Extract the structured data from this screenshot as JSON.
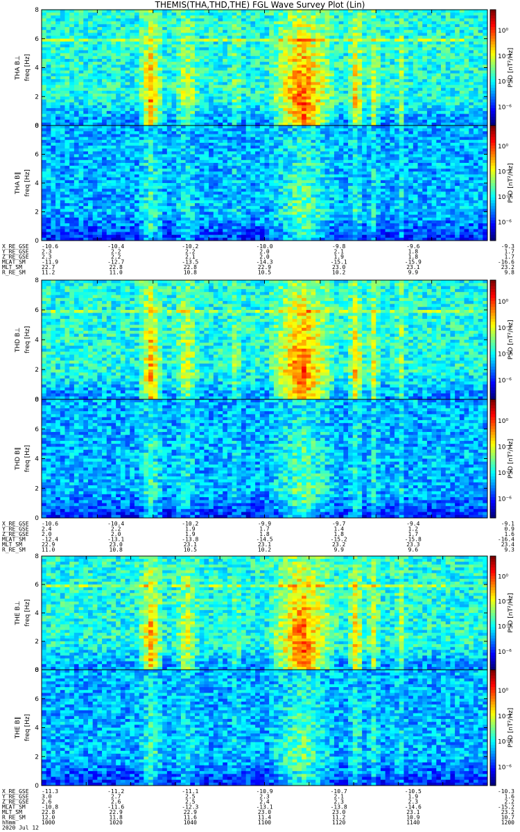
{
  "title": "THEMIS(THA,THD,THE) FGL Wave Survey Plot (Lin)",
  "chart_data": [
    {
      "type": "heatmap",
      "probe": "THA",
      "panels": [
        {
          "ylabel": "THA B⊥",
          "yunit": "freq [Hz]",
          "cbar_label": "PSD [nT²/Hz]"
        },
        {
          "ylabel": "THA B∥",
          "yunit": "freq [Hz]",
          "cbar_label": "PSD [nT²/Hz]"
        }
      ],
      "ylim": [
        0,
        8
      ],
      "yticks": [
        "0",
        "2",
        "4",
        "6",
        "8"
      ],
      "cbar_ticks": [
        "10⁰",
        "10⁻²",
        "10⁻⁴",
        "10⁻⁶"
      ],
      "x_tick_positions": [
        1000,
        1020,
        1040,
        1060,
        1080,
        1100,
        1120,
        1140,
        1160
      ],
      "ephemeris": [
        {
          "name": "X_RE_GSE",
          "values": [
            "-10.6",
            "-10.4",
            "-10.2",
            "-10.0",
            "-9.8",
            "-9.6",
            "-9.3"
          ]
        },
        {
          "name": "Y_RE_GSE",
          "values": [
            "2.3",
            "2.2",
            "2.2",
            "2.0",
            "2.1",
            "1.8",
            "1.7"
          ]
        },
        {
          "name": "Z_RE_GSE",
          "values": [
            "2.3",
            "2.2",
            "2.1",
            "2.0",
            "1.9",
            "1.8",
            "1.7"
          ]
        },
        {
          "name": "MLAT_SM",
          "values": [
            "-11.9",
            "-12.7",
            "-13.5",
            "-14.3",
            "-15.1",
            "-15.9",
            "-16.6"
          ]
        },
        {
          "name": "MLT_SM",
          "values": [
            "22.7",
            "22.8",
            "22.8",
            "22.9",
            "23.0",
            "23.1",
            "23.2"
          ]
        },
        {
          "name": "R_RE_SM",
          "values": [
            "11.2",
            "11.0",
            "10.8",
            "10.5",
            "10.2",
            "9.9",
            "9.8"
          ]
        }
      ]
    },
    {
      "type": "heatmap",
      "probe": "THD",
      "panels": [
        {
          "ylabel": "THD B⊥",
          "yunit": "freq [Hz]",
          "cbar_label": "PSD [nT²/Hz]"
        },
        {
          "ylabel": "THD B∥",
          "yunit": "freq [Hz]",
          "cbar_label": "PSD [nT²/Hz]"
        }
      ],
      "ylim": [
        0,
        8
      ],
      "yticks": [
        "0",
        "2",
        "4",
        "6",
        "8"
      ],
      "cbar_ticks": [
        "10⁰",
        "10⁻²",
        "10⁻⁴",
        "10⁻⁶"
      ],
      "x_tick_positions": [
        1000,
        1020,
        1040,
        1060,
        1080,
        1100,
        1120,
        1140,
        1160
      ],
      "ephemeris": [
        {
          "name": "X_RE_GSE",
          "values": [
            "-10.6",
            "-10.4",
            "-10.2",
            "-9.9",
            "-9.7",
            "-9.4",
            "-9.1"
          ]
        },
        {
          "name": "Y_RE_GSE",
          "values": [
            "2.4",
            "2.2",
            "1.9",
            "1.7",
            "1.4",
            "1.2",
            "0.9"
          ]
        },
        {
          "name": "Z_RE_GSE",
          "values": [
            "2.0",
            "2.0",
            "1.9",
            "1.8",
            "1.8",
            "1.7",
            "1.6"
          ]
        },
        {
          "name": "MLAT_SM",
          "values": [
            "-12.4",
            "-13.1",
            "-13.8",
            "-14.5",
            "-15.2",
            "-15.8",
            "-16.4"
          ]
        },
        {
          "name": "MLT_SM",
          "values": [
            "22.9",
            "23.0",
            "23.1",
            "23.1",
            "23.2",
            "23.3",
            "23.4"
          ]
        },
        {
          "name": "R_RE_SM",
          "values": [
            "11.0",
            "10.8",
            "10.5",
            "10.2",
            "9.9",
            "9.6",
            "9.3"
          ]
        }
      ]
    },
    {
      "type": "heatmap",
      "probe": "THE",
      "panels": [
        {
          "ylabel": "THE B⊥",
          "yunit": "freq [Hz]",
          "cbar_label": "PSD [nT²/Hz]"
        },
        {
          "ylabel": "THE B∥",
          "yunit": "freq [Hz]",
          "cbar_label": "PSD [nT²/Hz]"
        }
      ],
      "ylim": [
        0,
        8
      ],
      "yticks": [
        "0",
        "2",
        "4",
        "6",
        "8"
      ],
      "cbar_ticks": [
        "10⁰",
        "10⁻²",
        "10⁻⁴",
        "10⁻⁶"
      ],
      "x_tick_positions": [
        1000,
        1020,
        1040,
        1060,
        1080,
        1100,
        1120,
        1140,
        1160,
        1180,
        1200
      ],
      "ephemeris": [
        {
          "name": "X_RE_GSE",
          "values": [
            "-11.3",
            "-11.2",
            "-11.1",
            "-10.9",
            "-10.7",
            "-10.5",
            "-10.3"
          ]
        },
        {
          "name": "Y_RE_GSE",
          "values": [
            "3.0",
            "2.7",
            "2.5",
            "2.3",
            "2.1",
            "1.9",
            "1.6"
          ]
        },
        {
          "name": "Z_RE_GSE",
          "values": [
            "2.6",
            "2.6",
            "2.5",
            "2.4",
            "2.3",
            "2.3",
            "2.2"
          ]
        },
        {
          "name": "MLAT_SM",
          "values": [
            "-10.8",
            "-11.6",
            "-12.3",
            "-13.1",
            "-13.8",
            "-14.6",
            "-15.2"
          ]
        },
        {
          "name": "MLT_SM",
          "values": [
            "22.8",
            "22.9",
            "22.9",
            "23.0",
            "23.0",
            "23.1",
            "23.2"
          ]
        },
        {
          "name": "R_RE_SM",
          "values": [
            "12.0",
            "11.8",
            "11.6",
            "11.4",
            "11.2",
            "10.9",
            "10.7"
          ]
        },
        {
          "name": "hhmm",
          "values": [
            "1000",
            "1020",
            "1040",
            "1100",
            "1120",
            "1140",
            "1200"
          ]
        }
      ],
      "date": "2020 Jul 12"
    }
  ]
}
